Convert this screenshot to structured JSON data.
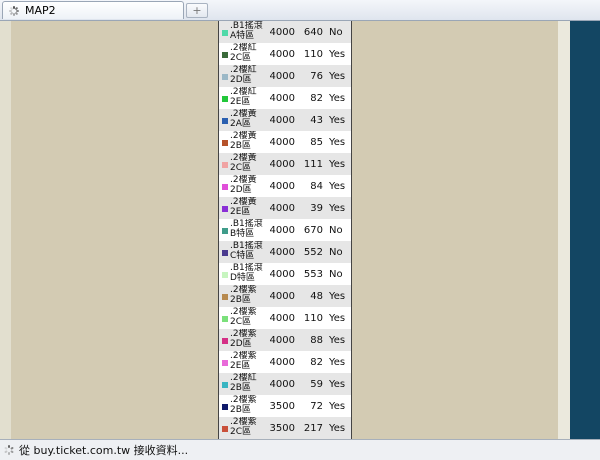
{
  "browser": {
    "tab_title": "MAP2",
    "new_tab_label": "+",
    "status_text": "從 buy.ticket.com.tw 接收資料..."
  },
  "table": {
    "rows": [
      {
        "name": ".B1搖滾\nA特區",
        "color": "#4fd9a8",
        "qty": "4000",
        "count": "640",
        "available": "No"
      },
      {
        "name": ".2樓紅\n2C區",
        "color": "#3b6b3b",
        "qty": "4000",
        "count": "110",
        "available": "Yes"
      },
      {
        "name": ".2樓紅\n2D區",
        "color": "#9bb8c7",
        "qty": "4000",
        "count": "76",
        "available": "Yes"
      },
      {
        "name": ".2樓紅\n2E區",
        "color": "#22c73a",
        "qty": "4000",
        "count": "82",
        "available": "Yes"
      },
      {
        "name": ".2樓黃\n2A區",
        "color": "#2a5fb0",
        "qty": "4000",
        "count": "43",
        "available": "Yes"
      },
      {
        "name": ".2樓黃\n2B區",
        "color": "#b6522a",
        "qty": "4000",
        "count": "85",
        "available": "Yes"
      },
      {
        "name": ".2樓黃\n2C區",
        "color": "#f0a3a3",
        "qty": "4000",
        "count": "111",
        "available": "Yes"
      },
      {
        "name": ".2樓黃\n2D區",
        "color": "#e04fd9",
        "qty": "4000",
        "count": "84",
        "available": "Yes"
      },
      {
        "name": ".2樓黃\n2E區",
        "color": "#8a2fd6",
        "qty": "4000",
        "count": "39",
        "available": "Yes"
      },
      {
        "name": ".B1搖滾\nB特區",
        "color": "#3f9c8a",
        "qty": "4000",
        "count": "670",
        "available": "No"
      },
      {
        "name": ".B1搖滾\nC特區",
        "color": "#4a3a8f",
        "qty": "4000",
        "count": "552",
        "available": "No"
      },
      {
        "name": ".B1搖滾\nD特區",
        "color": "#c7f5c0",
        "qty": "4000",
        "count": "553",
        "available": "No"
      },
      {
        "name": ".2樓紫\n2B區",
        "color": "#b78a4f",
        "qty": "4000",
        "count": "48",
        "available": "Yes"
      },
      {
        "name": ".2樓紫\n2C區",
        "color": "#7be07b",
        "qty": "4000",
        "count": "110",
        "available": "Yes"
      },
      {
        "name": ".2樓紫\n2D區",
        "color": "#d42f86",
        "qty": "4000",
        "count": "88",
        "available": "Yes"
      },
      {
        "name": ".2樓紫\n2E區",
        "color": "#e86ad9",
        "qty": "4000",
        "count": "82",
        "available": "Yes"
      },
      {
        "name": ".2樓紅\n2B區",
        "color": "#39b5c2",
        "qty": "4000",
        "count": "59",
        "available": "Yes"
      },
      {
        "name": ".2樓紫\n2B區",
        "color": "#101a6b",
        "qty": "3500",
        "count": "72",
        "available": "Yes"
      },
      {
        "name": ".2樓紫\n2C區",
        "color": "#c9503a",
        "qty": "3500",
        "count": "217",
        "available": "Yes"
      }
    ]
  }
}
